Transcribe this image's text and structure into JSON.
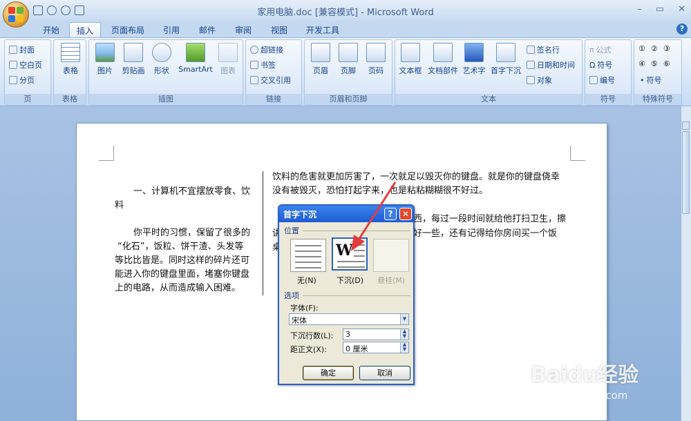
{
  "window": {
    "title": "家用电脑.doc [兼容模式] - Microsoft Word",
    "controls": [
      "–",
      "▭",
      "✕"
    ]
  },
  "tabs": [
    "开始",
    "插入",
    "页面布局",
    "引用",
    "邮件",
    "审阅",
    "视图",
    "开发工具"
  ],
  "ribbon": {
    "page_group": {
      "label": "页",
      "items": [
        "封面",
        "空白页",
        "分页"
      ]
    },
    "table_group": {
      "label": "表格",
      "item": "表格"
    },
    "illustrations_group": {
      "label": "插图",
      "items": [
        "图片",
        "剪贴画",
        "形状",
        "SmartArt",
        "图表"
      ]
    },
    "links_group": {
      "label": "链接",
      "items": [
        "超链接",
        "书签",
        "交叉引用"
      ]
    },
    "header_footer_group": {
      "label": "页眉和页脚",
      "items": [
        "页眉",
        "页脚",
        "页码"
      ]
    },
    "text_group": {
      "label": "文本",
      "big_items": [
        "文本框",
        "文档部件",
        "艺术字",
        "首字下沉"
      ],
      "small_items": [
        "签名行",
        "日期和时间",
        "对象"
      ]
    },
    "symbols_group": {
      "label": "符号",
      "items": [
        "公式",
        "符号",
        "编号"
      ]
    },
    "special_group": {
      "label": "特殊符号",
      "symbols": [
        "①",
        "②",
        "③",
        "④",
        "⑤",
        "⑥"
      ],
      "symbol_button": "符号"
    }
  },
  "document": {
    "left_heading": "一、计算机不宜摆放零食、饮",
    "left_heading_2": "料",
    "left_para": [
      "你平时的习惯，保留了很多的",
      "“化石”，饭粒、饼干渣、头发等",
      "等比比皆是。同时这样的碎片还可",
      "能进入你的键盘里面，堵塞你键盘",
      "上的电路，从而造成输入困难。"
    ],
    "right_para1": [
      "饮料的危害就更加厉害了，一次就足以毁灭你的键盘。就是你的键盘侥幸",
      "没有被毁灭，恐怕打起字来，也是粘粘糊糊很不好过。"
    ],
    "right_para2": [
      "西，每过一段时间就给他打扫卫生，擦",
      "好一些，还有记得给你房间买一个饭"
    ],
    "right_para2_prefix": [
      "讲",
      "桌"
    ]
  },
  "dialog": {
    "title": "首字下沉",
    "position_label": "位置",
    "options": [
      "无(N)",
      "下沉(D)",
      "悬挂(M)"
    ],
    "options_label": "选项",
    "font_label": "字体(F):",
    "font_value": "宋体",
    "lines_label": "下沉行数(L):",
    "lines_value": "3",
    "distance_label": "距正文(X):",
    "distance_value": "0 厘米",
    "ok": "确定",
    "cancel": "取消"
  },
  "watermark": {
    "brand": "Baidu经验",
    "url": "jingyan.baidu.com"
  }
}
